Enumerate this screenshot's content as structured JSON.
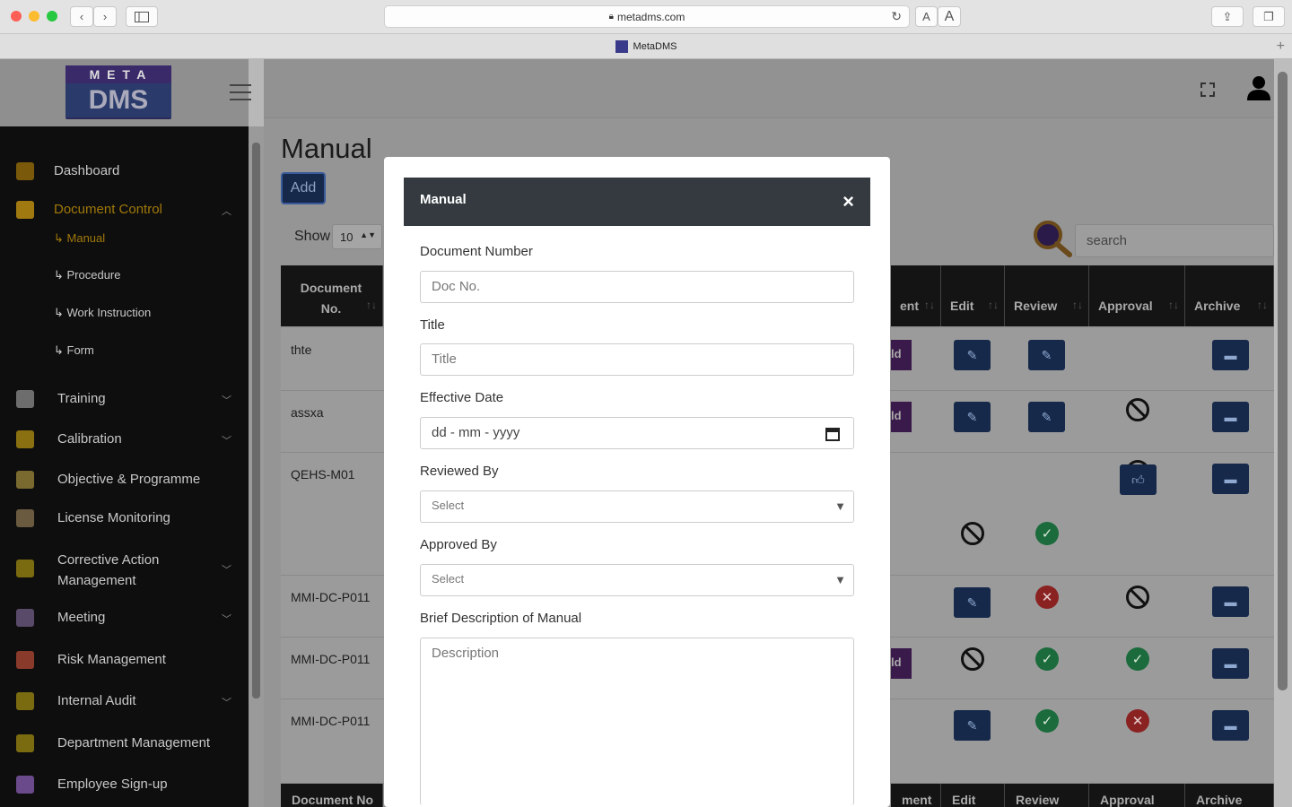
{
  "browser": {
    "url": "metadms.com",
    "tab_title": "MetaDMS",
    "text_size_small": "A",
    "text_size_large": "A"
  },
  "logo": {
    "line1": "M E T A",
    "line2": "DMS"
  },
  "sidebar": {
    "items": [
      {
        "label": "Dashboard",
        "icon": "bank-icon",
        "color": "#7a5a0a"
      },
      {
        "label": "Document Control",
        "icon": "folder-icon",
        "color": "#a07a10",
        "active": true
      },
      {
        "label": "Training",
        "icon": "book-icon",
        "color": "#6d6d6d"
      },
      {
        "label": "Calibration",
        "icon": "gauge-icon",
        "color": "#8a7010"
      },
      {
        "label": "Objective & Programme",
        "icon": "target-icon",
        "color": "#7a6a30"
      },
      {
        "label": "License Monitoring",
        "icon": "briefcase-icon",
        "color": "#6a5a40"
      },
      {
        "label": "Corrective Action Management",
        "icon": "clipboard-icon",
        "color": "#7a6a10"
      },
      {
        "label": "Meeting",
        "icon": "people-icon",
        "color": "#5a4a6a"
      },
      {
        "label": "Risk Management",
        "icon": "risk-gauge-icon",
        "color": "#8a3a2a"
      },
      {
        "label": "Internal Audit",
        "icon": "audit-icon",
        "color": "#7a6a10"
      },
      {
        "label": "Department Management",
        "icon": "org-icon",
        "color": "#7a6a10"
      },
      {
        "label": "Employee Sign-up",
        "icon": "user-icon",
        "color": "#6a4a8a"
      }
    ],
    "subitems": [
      "↳ Manual",
      "↳ Procedure",
      "↳ Work Instruction",
      "↳ Form"
    ]
  },
  "main": {
    "title": "Manual",
    "add_label": "Add",
    "show_label": "Show",
    "show_value": "10",
    "search_placeholder": "search",
    "columns": [
      "Document No.",
      "ent",
      "Edit",
      "Review",
      "Approval",
      "Archive"
    ],
    "rows": [
      {
        "doc": "thte"
      },
      {
        "doc": "assxa"
      },
      {
        "doc": "QEHS-M01"
      },
      {
        "doc": "MMI-DC-P011"
      },
      {
        "doc": "MMI-DC-P011"
      },
      {
        "doc": "MMI-DC-P011"
      }
    ],
    "footer_columns": [
      "Document No",
      "ment",
      "Edit",
      "Review",
      "Approval",
      "Archive"
    ],
    "partial_btn_label": "ld"
  },
  "modal": {
    "title": "Manual",
    "close": "×",
    "doc_number_label": "Document Number",
    "doc_number_placeholder": "Doc No.",
    "title_label": "Title",
    "title_placeholder": "Title",
    "date_label": "Effective Date",
    "date_placeholder": "dd - mm - yyyy",
    "reviewed_label": "Reviewed By",
    "reviewed_value": "Select",
    "approved_label": "Approved By",
    "approved_value": "Select",
    "desc_label": "Brief Description of Manual",
    "desc_placeholder": "Description"
  }
}
